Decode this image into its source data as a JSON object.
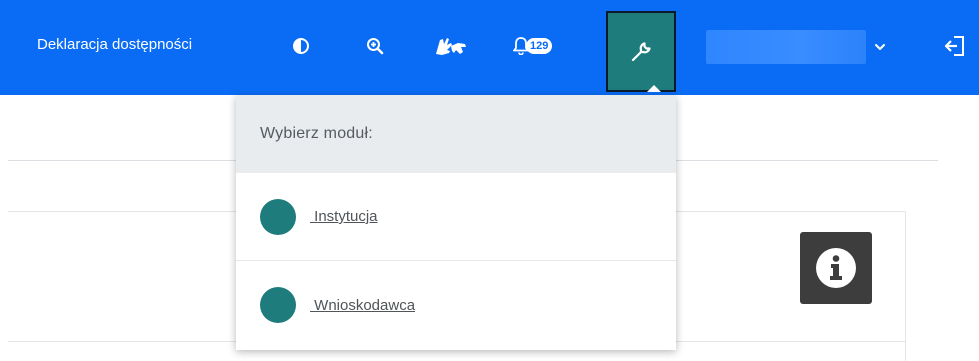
{
  "topbar": {
    "accessibility_label": "Deklaracja dostępności",
    "notifications_count": "129",
    "user_select_value": ""
  },
  "module_menu": {
    "header": "Wybierz moduł:",
    "items": [
      {
        "label": " Instytucja"
      },
      {
        "label": " Wnioskodawca"
      }
    ]
  },
  "colors": {
    "topbar": "#0a6cf5",
    "accent": "#1f7c7d",
    "info_box": "#3d3d3d"
  },
  "icons": [
    "contrast-icon",
    "zoom-in-icon",
    "sign-language-icon",
    "bell-icon",
    "wrench-icon",
    "chevron-down-icon",
    "logout-icon",
    "info-icon"
  ]
}
